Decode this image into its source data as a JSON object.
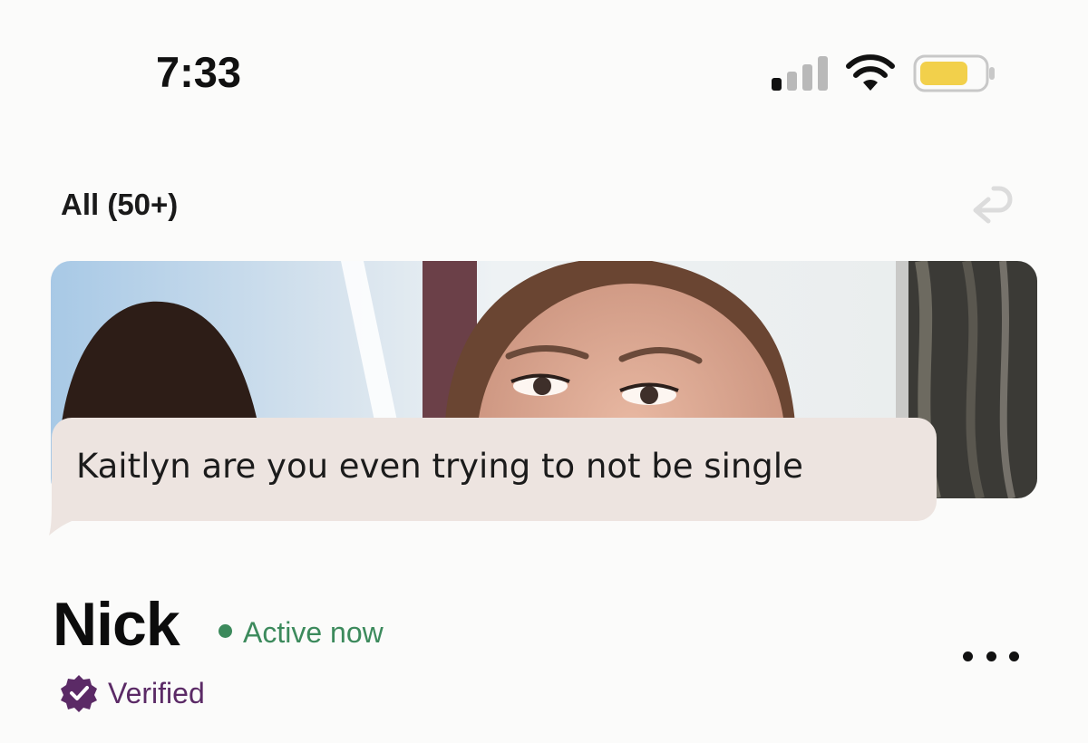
{
  "status_bar": {
    "time": "7:33",
    "icons": [
      "cellular-signal-icon",
      "wifi-icon",
      "battery-icon"
    ],
    "battery_color": "#f2d04b"
  },
  "header": {
    "filter_label": "All (50+)",
    "undo_icon": "undo-arrow-icon"
  },
  "card": {
    "message": "Kaitlyn are you even trying to not be single"
  },
  "profile": {
    "name": "Nick",
    "status": "Active now",
    "status_color": "#3c8a5c",
    "verified_label": "Verified",
    "verified_color": "#5b2a66",
    "more_icon": "more-options-icon"
  }
}
